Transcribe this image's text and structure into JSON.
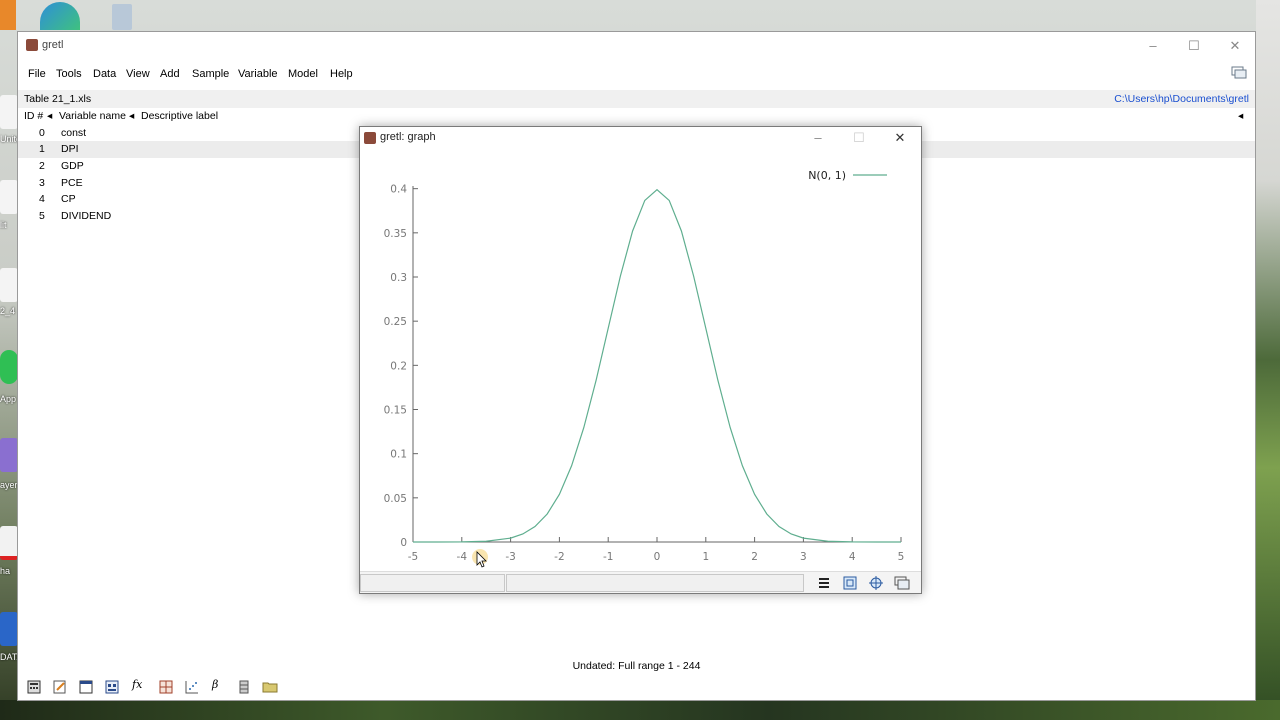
{
  "desktop": {
    "labels": [
      "Unite",
      "lit",
      "2_4",
      "App",
      "ayer",
      "ha",
      "DATA"
    ]
  },
  "main_window": {
    "title": "gretl",
    "controls": {
      "minimize": "–",
      "maximize": "☐",
      "close": "✕"
    },
    "menu": [
      {
        "label": "File",
        "key": "F"
      },
      {
        "label": "Tools",
        "key": "T"
      },
      {
        "label": "Data",
        "key": "D"
      },
      {
        "label": "View",
        "key": "V"
      },
      {
        "label": "Add",
        "key": "A"
      },
      {
        "label": "Sample",
        "key": "S"
      },
      {
        "label": "Variable",
        "key": "V"
      },
      {
        "label": "Model",
        "key": "M"
      },
      {
        "label": "Help",
        "key": "H"
      }
    ],
    "filename": "Table 21_1.xls",
    "path": "C:\\Users\\hp\\Documents\\gretl",
    "columns": {
      "id": "ID #",
      "name": "Variable name",
      "label": "Descriptive label"
    },
    "variables": [
      {
        "id": "0",
        "name": "const"
      },
      {
        "id": "1",
        "name": "DPI"
      },
      {
        "id": "2",
        "name": "GDP"
      },
      {
        "id": "3",
        "name": "PCE"
      },
      {
        "id": "4",
        "name": "CP"
      },
      {
        "id": "5",
        "name": "DIVIDEND"
      }
    ],
    "selected_row": 1,
    "status": "Undated: Full range 1 - 244",
    "toolbar_icons": [
      "calculator-icon",
      "script-editor-icon",
      "console-icon",
      "session-icon",
      "function-icon",
      "packages-icon",
      "graph-icon",
      "model-icon",
      "database-icon",
      "open-folder-icon"
    ],
    "toolbar_fx": "fx",
    "toolbar_beta": "β"
  },
  "graph_window": {
    "title": "gretl: graph",
    "controls": {
      "minimize": "–",
      "maximize": "☐",
      "close": "✕"
    },
    "toolbar_icons": [
      "menu-icon",
      "zoom-icon",
      "target-icon",
      "window-icon"
    ]
  },
  "chart_data": {
    "type": "line",
    "title": "",
    "xlabel": "",
    "ylabel": "",
    "xlim": [
      -5,
      5
    ],
    "ylim": [
      0,
      0.42
    ],
    "x_ticks": [
      "-5",
      "-4",
      "-3",
      "-2",
      "-1",
      "0",
      "1",
      "2",
      "3",
      "4",
      "5"
    ],
    "y_ticks": [
      "0",
      "0.05",
      "0.1",
      "0.15",
      "0.2",
      "0.25",
      "0.3",
      "0.35",
      "0.4"
    ],
    "legend_position": "top-right",
    "series": [
      {
        "name": "N(0, 1)",
        "color": "#5fae8f",
        "x": [
          -5,
          -4.5,
          -4,
          -3.5,
          -3,
          -2.75,
          -2.5,
          -2.25,
          -2,
          -1.75,
          -1.5,
          -1.25,
          -1,
          -0.75,
          -0.5,
          -0.25,
          0,
          0.25,
          0.5,
          0.75,
          1,
          1.25,
          1.5,
          1.75,
          2,
          2.25,
          2.5,
          2.75,
          3,
          3.5,
          4,
          4.5,
          5
        ],
        "y": [
          1.5e-06,
          1.6e-05,
          0.00013,
          0.00087,
          0.0044,
          0.0091,
          0.0175,
          0.0317,
          0.054,
          0.0863,
          0.1295,
          0.1826,
          0.242,
          0.3011,
          0.3521,
          0.3867,
          0.3989,
          0.3867,
          0.3521,
          0.3011,
          0.242,
          0.1826,
          0.1295,
          0.0863,
          0.054,
          0.0317,
          0.0175,
          0.0091,
          0.0044,
          0.00087,
          0.00013,
          1.6e-05,
          1.5e-06
        ]
      }
    ]
  }
}
